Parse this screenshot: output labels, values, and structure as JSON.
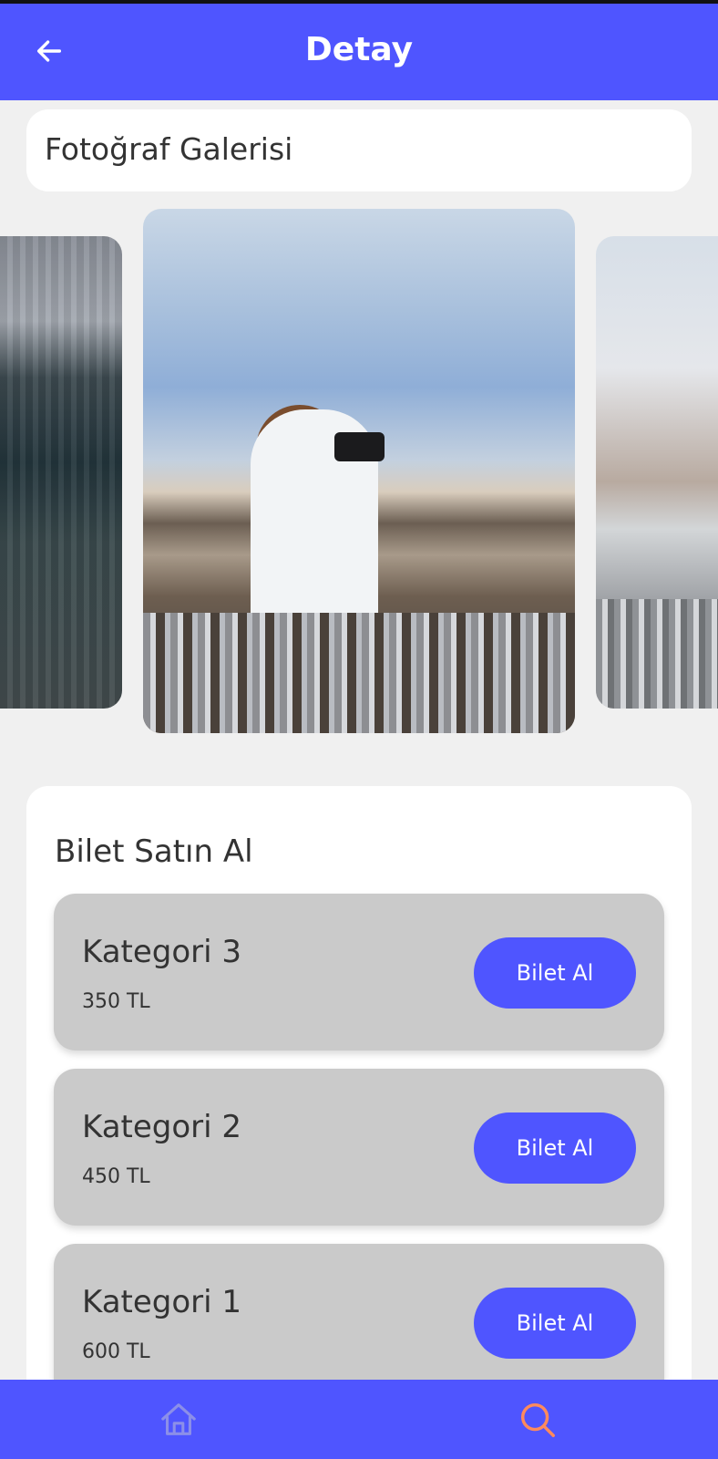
{
  "appbar": {
    "title": "Detay"
  },
  "gallery": {
    "title": "Fotoğraf Galerisi"
  },
  "tickets": {
    "heading": "Bilet Satın Al",
    "items": [
      {
        "name": "Kategori 3",
        "price": "350 TL",
        "button": "Bilet Al"
      },
      {
        "name": "Kategori 2",
        "price": "450 TL",
        "button": "Bilet Al"
      },
      {
        "name": "Kategori 1",
        "price": "600 TL",
        "button": "Bilet Al"
      }
    ]
  },
  "icons": {
    "back": "arrow-left-icon",
    "home": "home-icon",
    "search": "search-icon"
  },
  "colors": {
    "primary": "#4f55ff",
    "ticket_bg": "#cacaca",
    "nav_search_active": "#ff8a5c",
    "nav_home": "#8c8fe8"
  }
}
